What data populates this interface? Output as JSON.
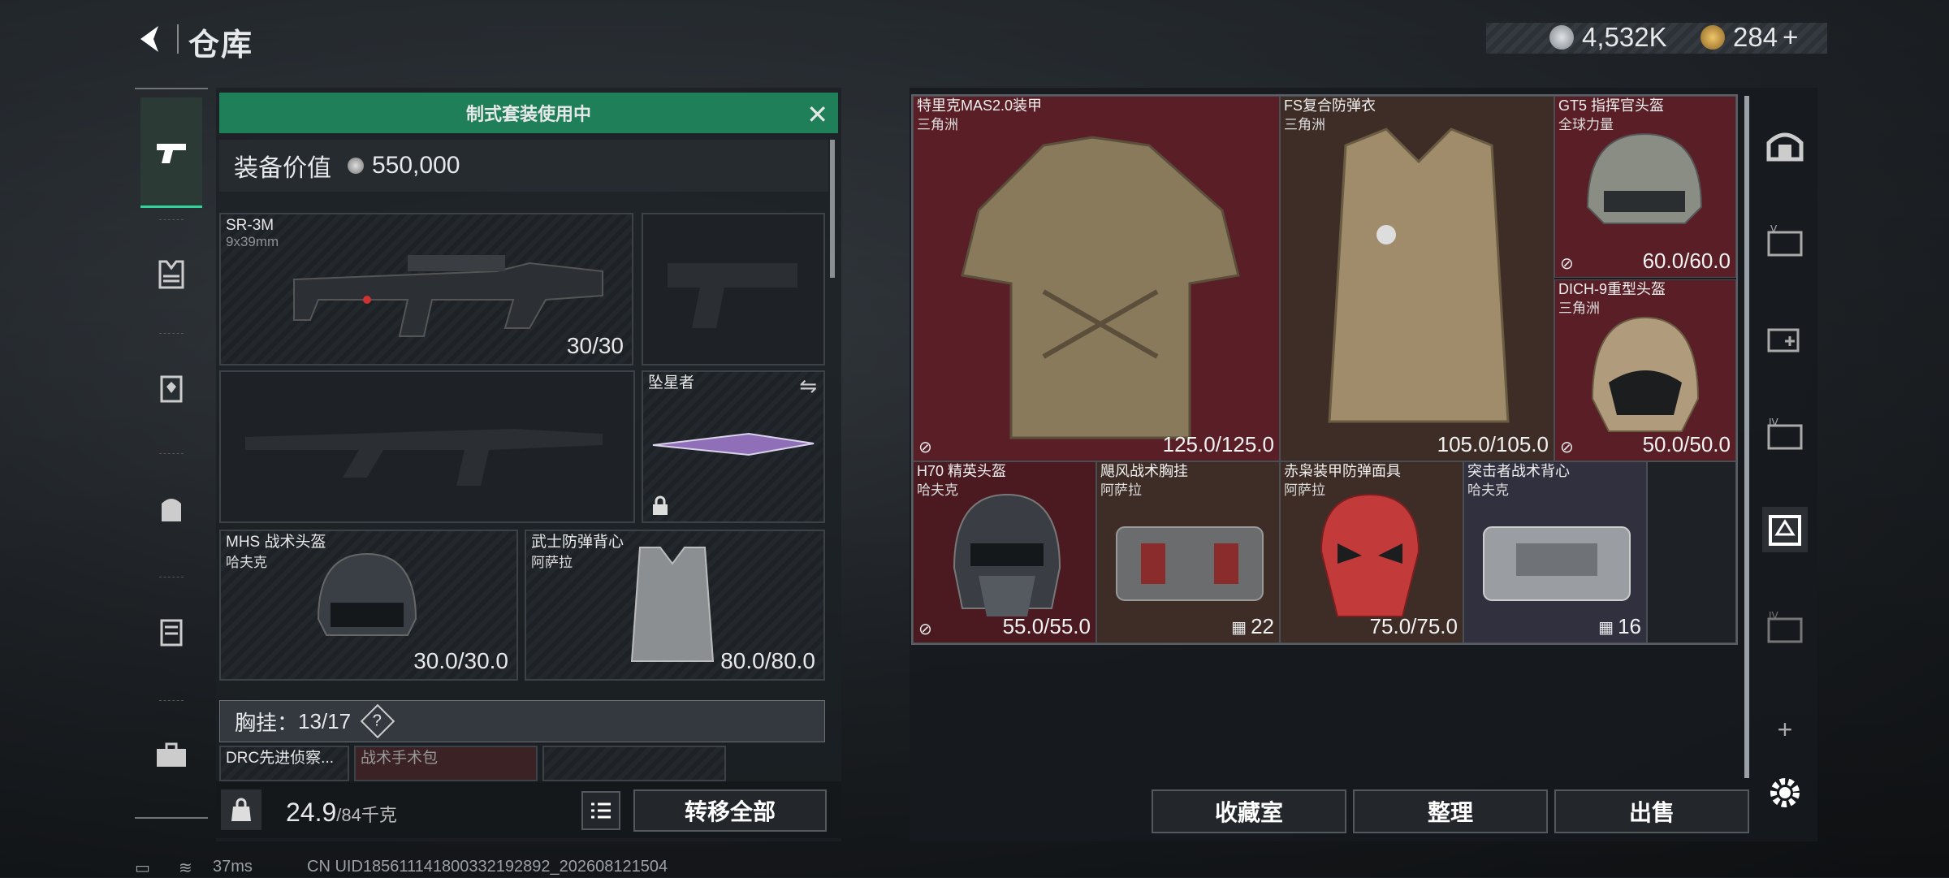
{
  "header": {
    "title": "仓库",
    "currency1": "4,532K",
    "currency2": "284",
    "plus": "+"
  },
  "left_nav": {
    "icons": [
      "pistol-icon",
      "vest-icon",
      "backpack-icon",
      "bag-icon",
      "locker-icon",
      "toolbox-icon"
    ]
  },
  "loadout": {
    "banner": "制式套装使用中",
    "value_label": "装备价值",
    "value": "550,000",
    "primary": {
      "name": "SR-3M",
      "caliber": "9x39mm",
      "ammo": "30/30"
    },
    "melee": {
      "name": "坠星者"
    },
    "helmet": {
      "name": "MHS 战术头盔",
      "faction": "哈夫克",
      "durability": "30.0/30.0"
    },
    "armor": {
      "name": "武士防弹背心",
      "faction": "阿萨拉",
      "durability": "80.0/80.0"
    },
    "chest_label": "胸挂：",
    "chest_value": "13/17",
    "help": "?",
    "bottom_items": [
      "DRC先进侦察...",
      "战术手术包"
    ],
    "weight": "24.9",
    "weight_max": "/84千克",
    "transfer_all": "转移全部"
  },
  "stash": {
    "items": [
      {
        "name": "特里克MAS2.0装甲",
        "faction": "三角洲",
        "durability": "125.0/125.0"
      },
      {
        "name": "FS复合防弹衣",
        "faction": "三角洲",
        "durability": "105.0/105.0"
      },
      {
        "name": "GT5 指挥官头盔",
        "faction": "全球力量",
        "durability": "60.0/60.0"
      },
      {
        "name": "DICH-9重型头盔",
        "faction": "三角洲",
        "durability": "50.0/50.0"
      },
      {
        "name": "H70 精英头盔",
        "faction": "哈夫克",
        "durability": "55.0/55.0"
      },
      {
        "name": "飓风战术胸挂",
        "faction": "阿萨拉",
        "capacity": "22"
      },
      {
        "name": "赤枭装甲防弹面具",
        "faction": "阿萨拉",
        "durability": "75.0/75.0"
      },
      {
        "name": "突击者战术背心",
        "faction": "哈夫克",
        "capacity": "16"
      }
    ],
    "btn_collection": "收藏室",
    "btn_sort": "整理",
    "btn_sell": "出售",
    "plus": "+"
  },
  "status": {
    "ping": "37ms",
    "uid": "CN UID18561114180033219289​2_202608121504"
  }
}
